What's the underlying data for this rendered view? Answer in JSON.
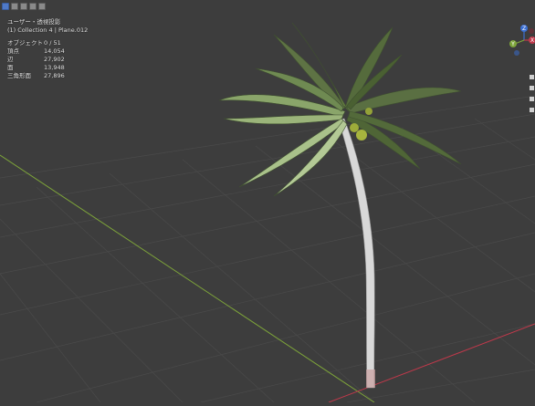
{
  "viewport": {
    "view_name": "ユーザー・透視投影",
    "collection_info": "(1) Collection 4 | Plane.012",
    "stats": [
      {
        "label": "オブジェクト",
        "value": "0 / 51"
      },
      {
        "label": "頂点",
        "value": "14,054"
      },
      {
        "label": "辺",
        "value": "27,902"
      },
      {
        "label": "面",
        "value": "13,948"
      },
      {
        "label": "三角形面",
        "value": "27,896"
      }
    ],
    "gizmo": {
      "x_label": "X",
      "y_label": "Y",
      "z_label": "Z"
    },
    "colors": {
      "background": "#3d3d3d",
      "grid": "#4a4a4a",
      "x_axis": "#c0394b",
      "y_axis": "#7ea53a",
      "leaf": "#7d9a5c",
      "trunk": "#d8d8d8"
    }
  },
  "toolbar": {
    "icons": [
      "select-box-icon",
      "select-extend-icon",
      "select-subtract-icon",
      "select-invert-icon",
      "select-intersect-icon"
    ]
  }
}
